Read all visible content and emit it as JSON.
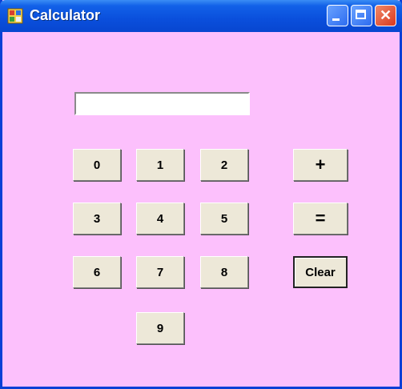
{
  "window": {
    "title": "Calculator"
  },
  "display": {
    "value": ""
  },
  "digits": [
    "0",
    "1",
    "2",
    "3",
    "4",
    "5",
    "6",
    "7",
    "8",
    "9"
  ],
  "operators": {
    "plus": "+",
    "equals": "=",
    "clear": "Clear"
  },
  "titlebar_buttons": {
    "close_glyph": "✕"
  }
}
